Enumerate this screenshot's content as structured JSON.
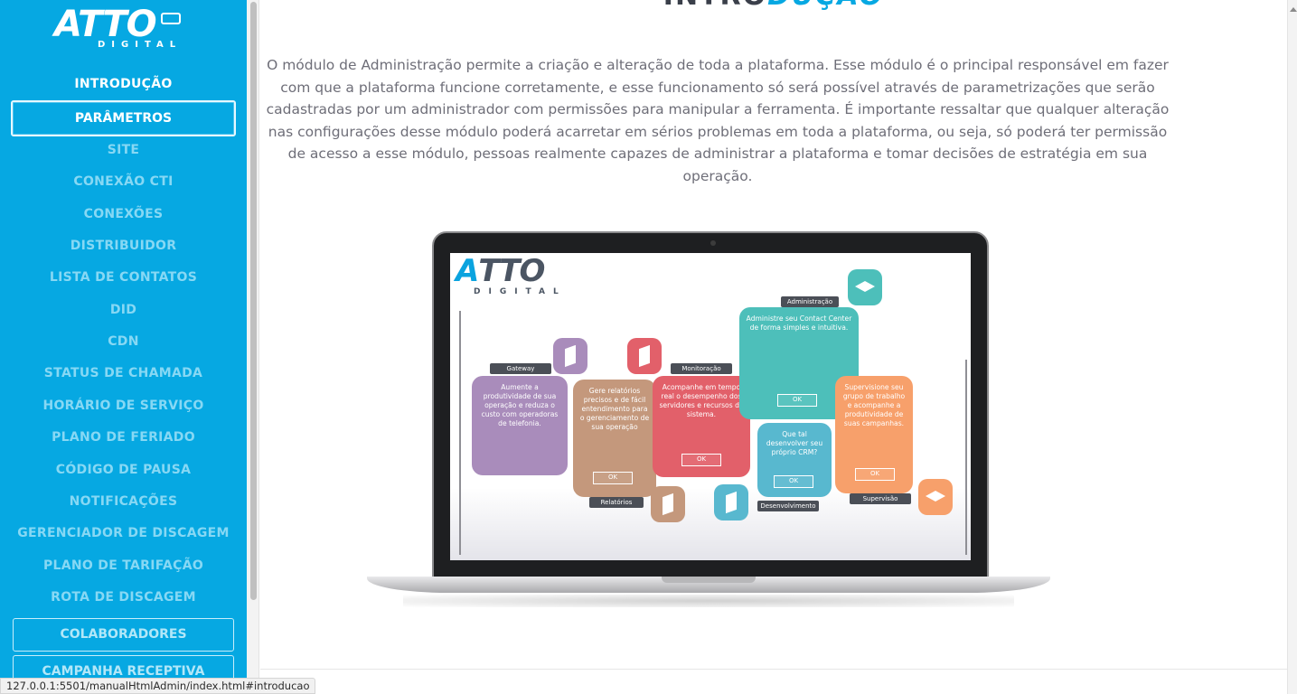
{
  "sidebar": {
    "logo_text": "ATTO",
    "logo_sub": "DIGITAL",
    "items": [
      {
        "label": "INTRODUÇÃO"
      },
      {
        "label": "PARÂMETROS"
      },
      {
        "label": "SITE"
      },
      {
        "label": "CONEXÃO CTI"
      },
      {
        "label": "CONEXÕES"
      },
      {
        "label": "DISTRIBUIDOR"
      },
      {
        "label": "LISTA DE CONTATOS"
      },
      {
        "label": "DID"
      },
      {
        "label": "CDN"
      },
      {
        "label": "STATUS DE CHAMADA"
      },
      {
        "label": "HORÁRIO DE SERVIÇO"
      },
      {
        "label": "PLANO DE FERIADO"
      },
      {
        "label": "CÓDIGO DE PAUSA"
      },
      {
        "label": "NOTIFICAÇÕES"
      },
      {
        "label": "GERENCIADOR DE DISCAGEM"
      },
      {
        "label": "PLANO DE TARIFAÇÃO"
      },
      {
        "label": "ROTA DE DISCAGEM"
      },
      {
        "label": "COLABORADORES"
      },
      {
        "label": "CAMPANHA RECEPTIVA"
      }
    ]
  },
  "main": {
    "title_a": "INTRO",
    "title_b": "DUÇÃO",
    "intro_text": "O módulo de Administração permite a criação e alteração de toda a plataforma. Esse módulo é o principal responsável em fazer com que a plataforma funcione corretamente, e esse funcionamento só será possível através de parametrizações que serão cadastradas por um administrador com permissões para manipular a ferramenta. É importante ressaltar que qualquer alteração nas configurações desse módulo poderá acarretar em sérios problemas em toda a plataforma, ou seja, só poderá ter permissão de acesso a esse módulo, pessoas realmente capazes de administrar a plataforma e tomar decisões de estratégia em sua operação."
  },
  "infographic": {
    "logo_text_a": "A",
    "logo_text_b": "TTO",
    "logo_sub": "DIGITAL",
    "ok_label": "OK",
    "cards": [
      {
        "tab": "Gateway",
        "text": "Aumente  a produtividade de sua operação e reduza o custo com operadoras de telefonia."
      },
      {
        "tab": "Relatórios",
        "text": "Gere relatórios precisos e de fácil entendimento para o gerenciamento de sua operação"
      },
      {
        "tab": "Monitoração",
        "text": "Acompanhe em tempo real o desempenho dos servidores e recursos do sistema."
      },
      {
        "tab": "Administração",
        "text": "Administre seu Contact Center de forma simples e intuitiva."
      },
      {
        "tab": "Desenvolvimento",
        "text": "Que tal desenvolver seu próprio CRM?"
      },
      {
        "tab": "Supervisão",
        "text": "Supervisione seu grupo de trabalho e acompanhe a produtividade de suas campanhas."
      }
    ],
    "colors": {
      "gateway": "#a98cbb",
      "relatorios": "#c4987c",
      "monitoracao": "#e2606a",
      "administracao": "#4dbfba",
      "desenvolvimento": "#58b8cf",
      "supervisao": "#f7a06b"
    }
  },
  "status_url": "127.0.0.1:5501/manualHtmlAdmin/index.html#introducao"
}
